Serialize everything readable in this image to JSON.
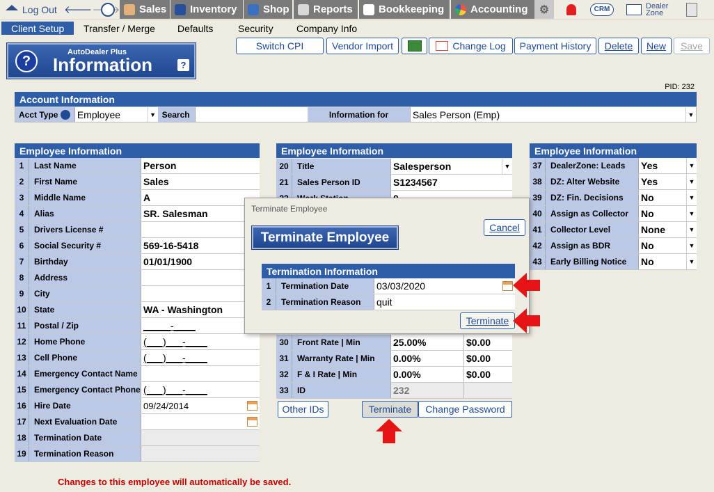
{
  "topnav": {
    "logout": "Log Out",
    "tabs": [
      "Sales",
      "Inventory",
      "Shop",
      "Reports",
      "Bookkeeping",
      "Accounting"
    ],
    "crm": "CRM",
    "dealer_zone": "Dealer\nZone"
  },
  "subnav": [
    "Client Setup",
    "Transfer / Merge",
    "Defaults",
    "Security",
    "Company Info"
  ],
  "logo": {
    "small": "AutoDealer Plus",
    "big": "Information",
    "help": "?",
    "q": "?"
  },
  "actions": {
    "switch_cpi": "Switch CPI",
    "vendor_import": "Vendor Import",
    "change_log": "Change Log",
    "payment_history": "Payment History",
    "delete": "Delete",
    "new": "New",
    "save": "Save"
  },
  "pid": "PID: 232",
  "account": {
    "header": "Account Information",
    "acct_type_label": "Acct Type",
    "acct_type_value": "Employee",
    "search_label": "Search",
    "search_value": "",
    "info_for_label": "Information for",
    "info_for_value": "Sales Person (Emp)"
  },
  "left_panel": {
    "header": "Employee Information",
    "rows": [
      {
        "n": "1",
        "label": "Last Name",
        "value": "Person"
      },
      {
        "n": "2",
        "label": "First Name",
        "value": "Sales"
      },
      {
        "n": "3",
        "label": "Middle Name",
        "value": "A"
      },
      {
        "n": "4",
        "label": "Alias",
        "value": "SR. Salesman"
      },
      {
        "n": "5",
        "label": "Drivers License #",
        "value": ""
      },
      {
        "n": "6",
        "label": "Social Security #",
        "value": "569-16-5418"
      },
      {
        "n": "7",
        "label": "Birthday",
        "value": "01/01/1900"
      },
      {
        "n": "8",
        "label": "Address",
        "value": ""
      },
      {
        "n": "9",
        "label": "City",
        "value": ""
      },
      {
        "n": "10",
        "label": "State",
        "value": "WA - Washington"
      },
      {
        "n": "11",
        "label": "Postal / Zip",
        "value": "_____-____"
      },
      {
        "n": "12",
        "label": "Home Phone",
        "value": "(___)___-____"
      },
      {
        "n": "13",
        "label": "Cell Phone",
        "value": "(___)___-____"
      },
      {
        "n": "14",
        "label": "Emergency Contact Name",
        "value": ""
      },
      {
        "n": "15",
        "label": "Emergency Contact Phone",
        "value": "(___)___-____"
      },
      {
        "n": "16",
        "label": "Hire Date",
        "value": "09/24/2014"
      },
      {
        "n": "17",
        "label": "Next Evaluation Date",
        "value": ""
      },
      {
        "n": "18",
        "label": "Termination Date",
        "value": ""
      },
      {
        "n": "19",
        "label": "Termination Reason",
        "value": ""
      }
    ]
  },
  "mid_panel": {
    "header": "Employee Information",
    "rows_top": [
      {
        "n": "20",
        "label": "Title",
        "value": "Salesperson"
      },
      {
        "n": "21",
        "label": "Sales Person ID",
        "value": "S1234567"
      },
      {
        "n": "22",
        "label": "Work Station",
        "value": "0"
      }
    ],
    "rows_bottom": [
      {
        "n": "30",
        "label": "Front Rate | Min",
        "value": "25.00%",
        "value2": "$0.00"
      },
      {
        "n": "31",
        "label": "Warranty Rate | Min",
        "value": "0.00%",
        "value2": "$0.00"
      },
      {
        "n": "32",
        "label": "F & I Rate | Min",
        "value": "0.00%",
        "value2": "$0.00"
      },
      {
        "n": "33",
        "label": "ID",
        "value": "232",
        "value2": ""
      }
    ],
    "other_ids": "Other IDs",
    "terminate": "Terminate",
    "change_password": "Change Password"
  },
  "right_panel": {
    "header": "Employee Information",
    "rows": [
      {
        "n": "37",
        "label": "DealerZone:  Leads",
        "value": "Yes"
      },
      {
        "n": "38",
        "label": "DZ: Alter Website",
        "value": "Yes"
      },
      {
        "n": "39",
        "label": "DZ:  Fin. Decisions",
        "value": "No"
      },
      {
        "n": "40",
        "label": "Assign as Collector",
        "value": "No"
      },
      {
        "n": "41",
        "label": "Collector Level",
        "value": "None"
      },
      {
        "n": "42",
        "label": "Assign as BDR",
        "value": "No"
      },
      {
        "n": "43",
        "label": "Early Billing Notice",
        "value": "No"
      }
    ]
  },
  "modal": {
    "title": "Terminate Employee",
    "cancel": "Cancel",
    "banner": "Terminate Employee",
    "section": "Termination Information",
    "rows": [
      {
        "n": "1",
        "label": "Termination Date",
        "value": "03/03/2020"
      },
      {
        "n": "2",
        "label": "Termination Reason",
        "value": "quit"
      }
    ],
    "terminate": "Terminate"
  },
  "footer_note": "Changes to this employee will automatically be saved.",
  "colors": {
    "header_blue": "#2f5ea8",
    "label_bg": "#bcc9e6",
    "arrow_red": "#e51515",
    "note_red": "#c00000"
  }
}
